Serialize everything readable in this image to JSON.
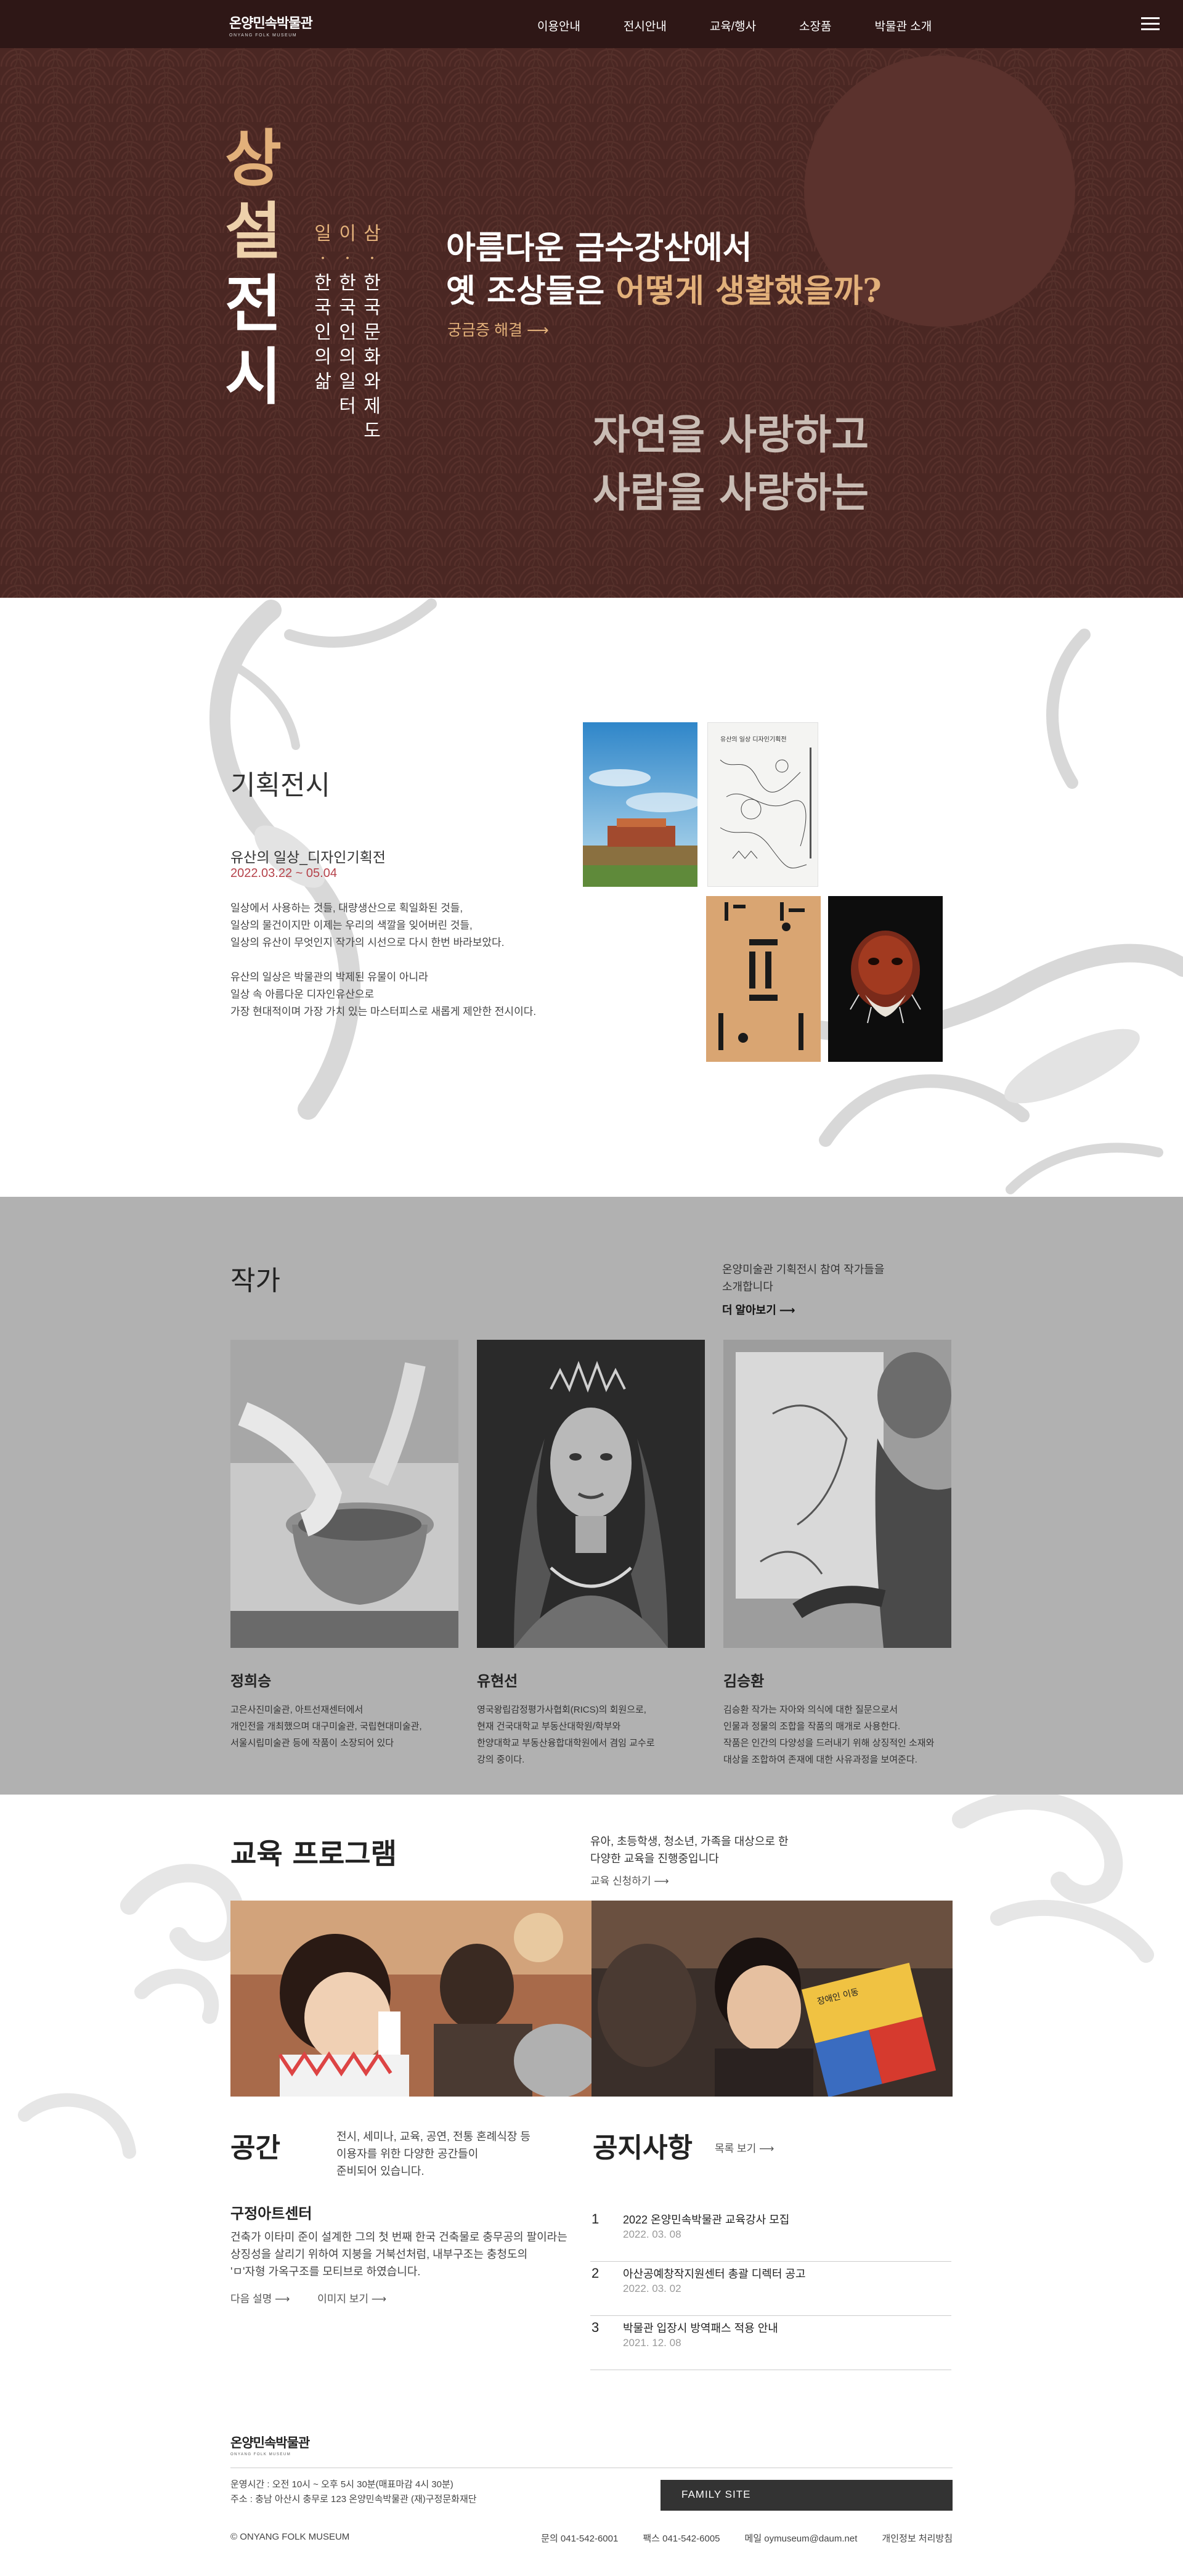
{
  "header": {
    "logo_ko": "온양민속박물관",
    "logo_en": "ONYANG FOLK MUSEUM",
    "nav": [
      "이용안내",
      "전시안내",
      "교육/행사",
      "소장품",
      "박물관 소개"
    ]
  },
  "hero": {
    "title_chars": [
      "상",
      "설",
      "전",
      "시"
    ],
    "columns": [
      [
        "삼",
        "·",
        "한",
        "국",
        "문",
        "화",
        "와",
        "제",
        "도"
      ],
      [
        "이",
        "·",
        "한",
        "국",
        "인",
        "의",
        "일",
        "터"
      ],
      [
        "일",
        "·",
        "한",
        "국",
        "인",
        "의",
        "삶"
      ]
    ],
    "question_line1": "아름다운 금수강산에서",
    "question_line2_prefix": "옛 조상들은 ",
    "question_line2_highlight": "어떻게 생활했을까?",
    "solve_link": "궁금증 해결 ⟶",
    "nature_line1": "자연을 사랑하고",
    "nature_line2": "사람을 사랑하는"
  },
  "special": {
    "heading": "기획전시",
    "title": "유산의 일상_디자인기획전",
    "date": "2022.03.22 ~ 05.04",
    "desc1_l1": "일상에서 사용하는 것들, 대량생산으로 획일화된 것들,",
    "desc1_l2": "일상의 물건이지만 이제는 우리의 색깔을 잊어버린 것들,",
    "desc1_l3": "일상의 유산이 무엇인지 작가의 시선으로 다시 한번 바라보았다.",
    "desc2_l1": "유산의 일상은 박물관의 박제된 유물이 아니라",
    "desc2_l2": "일상 속 아름다운 디자인유산으로",
    "desc2_l3": "가장 현대적이며 가장 가치 있는 마스터피스로 새롭게 제안한 전시이다.",
    "poster2_caption": "유산의 일상 디자인기획전"
  },
  "artists": {
    "heading": "작가",
    "intro_l1": "온양미술관 기획전시 참여 작가들을",
    "intro_l2": "소개합니다",
    "more": "더 알아보기 ⟶",
    "items": [
      {
        "name": "정희승",
        "bio_l1": "고은사진미술관, 아트선재센터에서",
        "bio_l2": "개인전을 개최했으며 대구미술관, 국립현대미술관,",
        "bio_l3": "서울시립미술관 등에 작품이 소장되어 있다"
      },
      {
        "name": "유현선",
        "bio_l1": "영국왕립감정평가사협회(RICS)의 회원으로,",
        "bio_l2": "현재 건국대학교 부동산대학원/학부와",
        "bio_l3": "한양대학교 부동산융합대학원에서 겸임 교수로",
        "bio_l4": "강의 중이다."
      },
      {
        "name": "김승환",
        "bio_l1": "김승환 작가는 자아와 의식에 대한 질문으로서",
        "bio_l2": "인물과 정물의 조합을 작품의 매개로 사용한다.",
        "bio_l3": "작품은 인간의 다양성을 드러내기 위해 상징적인 소재와",
        "bio_l4": "대상을 조합하여 존재에 대한 사유과정을 보여준다."
      }
    ]
  },
  "education": {
    "heading": "교육 프로그램",
    "intro_l1": "유아, 초등학생, 청소년, 가족을 대상으로 한",
    "intro_l2": "다양한 교육을 진행중입니다",
    "more": "교육 신청하기 ⟶",
    "flag_text": "장애인 이동"
  },
  "space": {
    "heading": "공간",
    "intro_l1": "전시, 세미나, 교육, 공연, 전통 혼례식장 등",
    "intro_l2": "이용자를 위한 다양한 공간들이",
    "intro_l3": "준비되어 있습니다.",
    "sub": "구정아트센터",
    "desc_l1": "건축가 이타미 준이 설계한 그의 첫 번째 한국 건축물로 충무공의 팔이라는",
    "desc_l2": "상징성을 살리기 위하여 지붕을 거북선처럼, 내부구조는 충청도의",
    "desc_l3": "'ㅁ'자형 가옥구조를 모티브로 하였습니다.",
    "link1": "다음 설명 ⟶",
    "link2": "이미지 보기 ⟶"
  },
  "notice": {
    "heading": "공지사항",
    "more": "목록 보기 ⟶",
    "items": [
      {
        "num": "1",
        "title": "2022 온양민속박물관 교육강사 모집",
        "date": "2022. 03. 08"
      },
      {
        "num": "2",
        "title": "아산공예창작지원센터 총괄 디렉터 공고",
        "date": "2022. 03. 02"
      },
      {
        "num": "3",
        "title": "박물관 입장시 방역패스 적용 안내",
        "date": "2021. 12. 08"
      }
    ]
  },
  "footer": {
    "logo_ko": "온양민속박물관",
    "logo_en": "ONYANG FOLK MUSEUM",
    "hours": "운영시간 : 오전 10시 ~ 오후 5시 30분(매표마감 4시 30분)",
    "address": "주소 : 충남 아산시 충무로 123 온양민속박물관 (재)구정문화재단",
    "family_site": "FAMILY SITE",
    "copyright": "© ONYANG FOLK MUSEUM",
    "phone": "문의 041-542-6001",
    "fax": "팩스 041-542-6005",
    "email": "메일 oymuseum@daum.net",
    "privacy": "개인정보 처리방침"
  },
  "colors": {
    "header_bg": "#2e1716",
    "hero_bg": "#4a2723",
    "accent": "#e2b07a",
    "date_red": "#b5424a",
    "artists_bg": "#b1b1b1"
  }
}
